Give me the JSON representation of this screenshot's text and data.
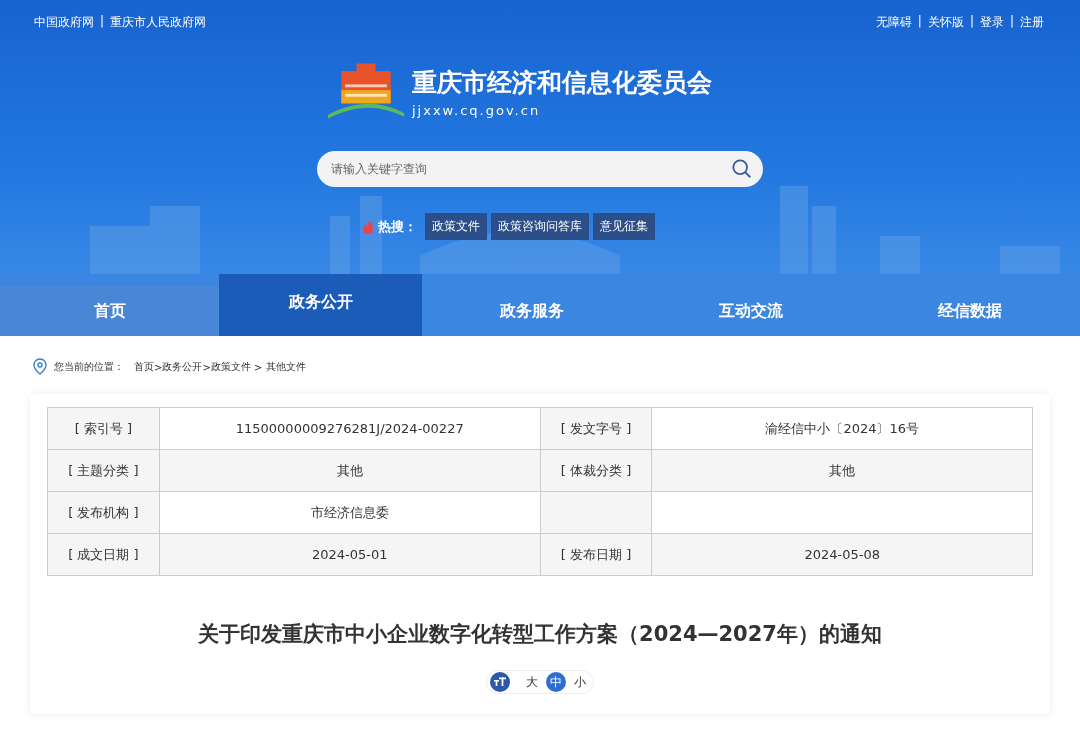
{
  "top_bar": {
    "left_links": [
      "中国政府网",
      "重庆市人民政府网"
    ],
    "right_links": [
      "无障碍",
      "关怀版",
      "登录",
      "注册"
    ],
    "separator": "|"
  },
  "site": {
    "name": "重庆市经济和信息化委员会",
    "domain": "jjxxw.cq.gov.cn"
  },
  "search": {
    "placeholder": "请输入关键字查询"
  },
  "hot_search": {
    "label": "热搜：",
    "tags": [
      "政策文件",
      "政策咨询问答库",
      "意见征集"
    ]
  },
  "nav": [
    {
      "label": "首页",
      "selected": false
    },
    {
      "label": "政务公开",
      "selected": true
    },
    {
      "label": "政务服务",
      "selected": false
    },
    {
      "label": "互动交流",
      "selected": false
    },
    {
      "label": "经信数据",
      "selected": false
    }
  ],
  "breadcrumb": {
    "label": "您当前的位置：",
    "items": [
      "首页",
      "政务公开",
      "政策文件",
      "其他文件"
    ],
    "separators": [
      ">",
      ">",
      " > "
    ]
  },
  "info_table": [
    {
      "pairs": [
        {
          "label": "[ 索引号 ]",
          "value": "11500000009276281J/2024-00227"
        },
        {
          "label": "[ 发文字号 ]",
          "value": "渝经信中小〔2024〕16号"
        }
      ]
    },
    {
      "pairs": [
        {
          "label": "[ 主题分类 ]",
          "value": "其他"
        },
        {
          "label": "[ 体裁分类 ]",
          "value": "其他"
        }
      ]
    },
    {
      "pairs": [
        {
          "label": "[ 发布机构 ]",
          "value": "市经济信息委"
        }
      ]
    },
    {
      "pairs": [
        {
          "label": "[ 成文日期 ]",
          "value": "2024-05-01"
        },
        {
          "label": "[ 发布日期 ]",
          "value": "2024-05-08"
        }
      ]
    }
  ],
  "article_title": "关于印发重庆市中小企业数字化转型工作方案（2024—2027年）的通知",
  "font_size": {
    "options": [
      {
        "label": "大",
        "selected": false
      },
      {
        "label": "中",
        "selected": true
      },
      {
        "label": "小",
        "selected": false
      }
    ]
  }
}
